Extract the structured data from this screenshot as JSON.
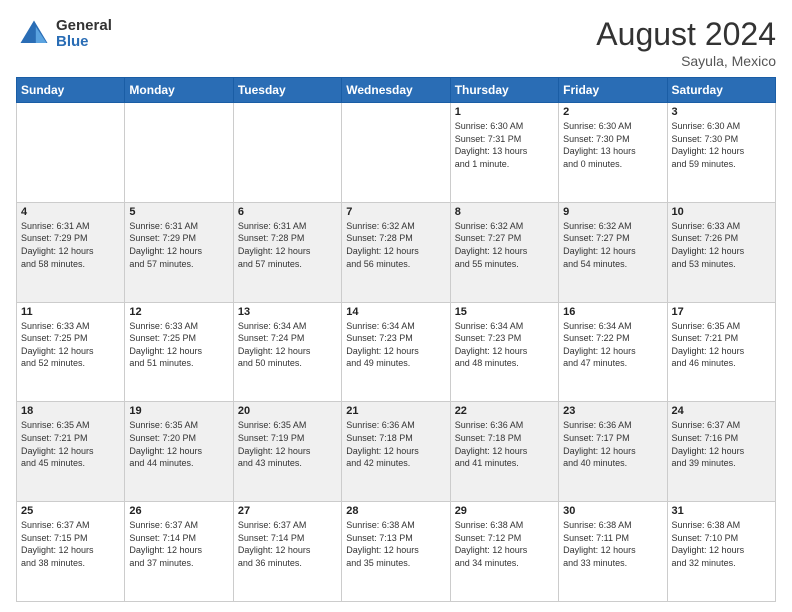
{
  "logo": {
    "general": "General",
    "blue": "Blue"
  },
  "header": {
    "month_title": "August 2024",
    "subtitle": "Sayula, Mexico"
  },
  "days_of_week": [
    "Sunday",
    "Monday",
    "Tuesday",
    "Wednesday",
    "Thursday",
    "Friday",
    "Saturday"
  ],
  "weeks": [
    [
      {
        "day": "",
        "info": ""
      },
      {
        "day": "",
        "info": ""
      },
      {
        "day": "",
        "info": ""
      },
      {
        "day": "",
        "info": ""
      },
      {
        "day": "1",
        "info": "Sunrise: 6:30 AM\nSunset: 7:31 PM\nDaylight: 13 hours\nand 1 minute."
      },
      {
        "day": "2",
        "info": "Sunrise: 6:30 AM\nSunset: 7:30 PM\nDaylight: 13 hours\nand 0 minutes."
      },
      {
        "day": "3",
        "info": "Sunrise: 6:30 AM\nSunset: 7:30 PM\nDaylight: 12 hours\nand 59 minutes."
      }
    ],
    [
      {
        "day": "4",
        "info": "Sunrise: 6:31 AM\nSunset: 7:29 PM\nDaylight: 12 hours\nand 58 minutes."
      },
      {
        "day": "5",
        "info": "Sunrise: 6:31 AM\nSunset: 7:29 PM\nDaylight: 12 hours\nand 57 minutes."
      },
      {
        "day": "6",
        "info": "Sunrise: 6:31 AM\nSunset: 7:28 PM\nDaylight: 12 hours\nand 57 minutes."
      },
      {
        "day": "7",
        "info": "Sunrise: 6:32 AM\nSunset: 7:28 PM\nDaylight: 12 hours\nand 56 minutes."
      },
      {
        "day": "8",
        "info": "Sunrise: 6:32 AM\nSunset: 7:27 PM\nDaylight: 12 hours\nand 55 minutes."
      },
      {
        "day": "9",
        "info": "Sunrise: 6:32 AM\nSunset: 7:27 PM\nDaylight: 12 hours\nand 54 minutes."
      },
      {
        "day": "10",
        "info": "Sunrise: 6:33 AM\nSunset: 7:26 PM\nDaylight: 12 hours\nand 53 minutes."
      }
    ],
    [
      {
        "day": "11",
        "info": "Sunrise: 6:33 AM\nSunset: 7:25 PM\nDaylight: 12 hours\nand 52 minutes."
      },
      {
        "day": "12",
        "info": "Sunrise: 6:33 AM\nSunset: 7:25 PM\nDaylight: 12 hours\nand 51 minutes."
      },
      {
        "day": "13",
        "info": "Sunrise: 6:34 AM\nSunset: 7:24 PM\nDaylight: 12 hours\nand 50 minutes."
      },
      {
        "day": "14",
        "info": "Sunrise: 6:34 AM\nSunset: 7:23 PM\nDaylight: 12 hours\nand 49 minutes."
      },
      {
        "day": "15",
        "info": "Sunrise: 6:34 AM\nSunset: 7:23 PM\nDaylight: 12 hours\nand 48 minutes."
      },
      {
        "day": "16",
        "info": "Sunrise: 6:34 AM\nSunset: 7:22 PM\nDaylight: 12 hours\nand 47 minutes."
      },
      {
        "day": "17",
        "info": "Sunrise: 6:35 AM\nSunset: 7:21 PM\nDaylight: 12 hours\nand 46 minutes."
      }
    ],
    [
      {
        "day": "18",
        "info": "Sunrise: 6:35 AM\nSunset: 7:21 PM\nDaylight: 12 hours\nand 45 minutes."
      },
      {
        "day": "19",
        "info": "Sunrise: 6:35 AM\nSunset: 7:20 PM\nDaylight: 12 hours\nand 44 minutes."
      },
      {
        "day": "20",
        "info": "Sunrise: 6:35 AM\nSunset: 7:19 PM\nDaylight: 12 hours\nand 43 minutes."
      },
      {
        "day": "21",
        "info": "Sunrise: 6:36 AM\nSunset: 7:18 PM\nDaylight: 12 hours\nand 42 minutes."
      },
      {
        "day": "22",
        "info": "Sunrise: 6:36 AM\nSunset: 7:18 PM\nDaylight: 12 hours\nand 41 minutes."
      },
      {
        "day": "23",
        "info": "Sunrise: 6:36 AM\nSunset: 7:17 PM\nDaylight: 12 hours\nand 40 minutes."
      },
      {
        "day": "24",
        "info": "Sunrise: 6:37 AM\nSunset: 7:16 PM\nDaylight: 12 hours\nand 39 minutes."
      }
    ],
    [
      {
        "day": "25",
        "info": "Sunrise: 6:37 AM\nSunset: 7:15 PM\nDaylight: 12 hours\nand 38 minutes."
      },
      {
        "day": "26",
        "info": "Sunrise: 6:37 AM\nSunset: 7:14 PM\nDaylight: 12 hours\nand 37 minutes."
      },
      {
        "day": "27",
        "info": "Sunrise: 6:37 AM\nSunset: 7:14 PM\nDaylight: 12 hours\nand 36 minutes."
      },
      {
        "day": "28",
        "info": "Sunrise: 6:38 AM\nSunset: 7:13 PM\nDaylight: 12 hours\nand 35 minutes."
      },
      {
        "day": "29",
        "info": "Sunrise: 6:38 AM\nSunset: 7:12 PM\nDaylight: 12 hours\nand 34 minutes."
      },
      {
        "day": "30",
        "info": "Sunrise: 6:38 AM\nSunset: 7:11 PM\nDaylight: 12 hours\nand 33 minutes."
      },
      {
        "day": "31",
        "info": "Sunrise: 6:38 AM\nSunset: 7:10 PM\nDaylight: 12 hours\nand 32 minutes."
      }
    ]
  ]
}
